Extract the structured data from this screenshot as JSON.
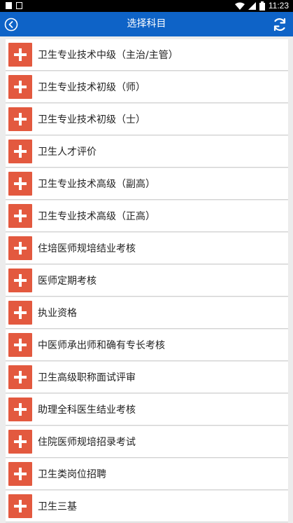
{
  "status_bar": {
    "time": "11:23"
  },
  "header": {
    "title": "选择科目"
  },
  "list": {
    "items": [
      {
        "label": "卫生专业技术中级（主治/主管）"
      },
      {
        "label": "卫生专业技术初级（师）"
      },
      {
        "label": "卫生专业技术初级（士）"
      },
      {
        "label": "卫生人才评价"
      },
      {
        "label": "卫生专业技术高级（副高）"
      },
      {
        "label": "卫生专业技术高级（正高）"
      },
      {
        "label": "住培医师规培结业考核"
      },
      {
        "label": "医师定期考核"
      },
      {
        "label": "执业资格"
      },
      {
        "label": "中医师承出师和确有专长考核"
      },
      {
        "label": "卫生高级职称面试评审"
      },
      {
        "label": "助理全科医生结业考核"
      },
      {
        "label": "住院医师规培招录考试"
      },
      {
        "label": "卫生类岗位招聘"
      },
      {
        "label": "卫生三基"
      }
    ]
  },
  "icons": {
    "back": "back-circle-icon",
    "refresh": "refresh-icon",
    "add": "plus-icon"
  },
  "colors": {
    "app_bar": "#0e63c7",
    "plus_box": "#e3593f",
    "background": "#ececec"
  }
}
